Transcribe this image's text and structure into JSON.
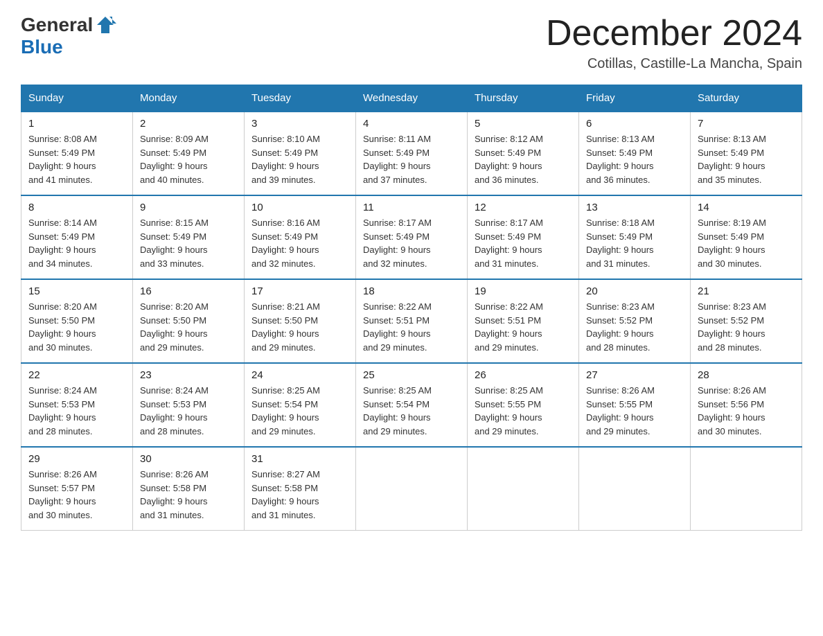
{
  "header": {
    "logo_general": "General",
    "logo_blue": "Blue",
    "month_title": "December 2024",
    "location": "Cotillas, Castille-La Mancha, Spain"
  },
  "weekdays": [
    "Sunday",
    "Monday",
    "Tuesday",
    "Wednesday",
    "Thursday",
    "Friday",
    "Saturday"
  ],
  "weeks": [
    [
      {
        "day": "1",
        "sunrise": "8:08 AM",
        "sunset": "5:49 PM",
        "daylight": "9 hours and 41 minutes."
      },
      {
        "day": "2",
        "sunrise": "8:09 AM",
        "sunset": "5:49 PM",
        "daylight": "9 hours and 40 minutes."
      },
      {
        "day": "3",
        "sunrise": "8:10 AM",
        "sunset": "5:49 PM",
        "daylight": "9 hours and 39 minutes."
      },
      {
        "day": "4",
        "sunrise": "8:11 AM",
        "sunset": "5:49 PM",
        "daylight": "9 hours and 37 minutes."
      },
      {
        "day": "5",
        "sunrise": "8:12 AM",
        "sunset": "5:49 PM",
        "daylight": "9 hours and 36 minutes."
      },
      {
        "day": "6",
        "sunrise": "8:13 AM",
        "sunset": "5:49 PM",
        "daylight": "9 hours and 36 minutes."
      },
      {
        "day": "7",
        "sunrise": "8:13 AM",
        "sunset": "5:49 PM",
        "daylight": "9 hours and 35 minutes."
      }
    ],
    [
      {
        "day": "8",
        "sunrise": "8:14 AM",
        "sunset": "5:49 PM",
        "daylight": "9 hours and 34 minutes."
      },
      {
        "day": "9",
        "sunrise": "8:15 AM",
        "sunset": "5:49 PM",
        "daylight": "9 hours and 33 minutes."
      },
      {
        "day": "10",
        "sunrise": "8:16 AM",
        "sunset": "5:49 PM",
        "daylight": "9 hours and 32 minutes."
      },
      {
        "day": "11",
        "sunrise": "8:17 AM",
        "sunset": "5:49 PM",
        "daylight": "9 hours and 32 minutes."
      },
      {
        "day": "12",
        "sunrise": "8:17 AM",
        "sunset": "5:49 PM",
        "daylight": "9 hours and 31 minutes."
      },
      {
        "day": "13",
        "sunrise": "8:18 AM",
        "sunset": "5:49 PM",
        "daylight": "9 hours and 31 minutes."
      },
      {
        "day": "14",
        "sunrise": "8:19 AM",
        "sunset": "5:49 PM",
        "daylight": "9 hours and 30 minutes."
      }
    ],
    [
      {
        "day": "15",
        "sunrise": "8:20 AM",
        "sunset": "5:50 PM",
        "daylight": "9 hours and 30 minutes."
      },
      {
        "day": "16",
        "sunrise": "8:20 AM",
        "sunset": "5:50 PM",
        "daylight": "9 hours and 29 minutes."
      },
      {
        "day": "17",
        "sunrise": "8:21 AM",
        "sunset": "5:50 PM",
        "daylight": "9 hours and 29 minutes."
      },
      {
        "day": "18",
        "sunrise": "8:22 AM",
        "sunset": "5:51 PM",
        "daylight": "9 hours and 29 minutes."
      },
      {
        "day": "19",
        "sunrise": "8:22 AM",
        "sunset": "5:51 PM",
        "daylight": "9 hours and 29 minutes."
      },
      {
        "day": "20",
        "sunrise": "8:23 AM",
        "sunset": "5:52 PM",
        "daylight": "9 hours and 28 minutes."
      },
      {
        "day": "21",
        "sunrise": "8:23 AM",
        "sunset": "5:52 PM",
        "daylight": "9 hours and 28 minutes."
      }
    ],
    [
      {
        "day": "22",
        "sunrise": "8:24 AM",
        "sunset": "5:53 PM",
        "daylight": "9 hours and 28 minutes."
      },
      {
        "day": "23",
        "sunrise": "8:24 AM",
        "sunset": "5:53 PM",
        "daylight": "9 hours and 28 minutes."
      },
      {
        "day": "24",
        "sunrise": "8:25 AM",
        "sunset": "5:54 PM",
        "daylight": "9 hours and 29 minutes."
      },
      {
        "day": "25",
        "sunrise": "8:25 AM",
        "sunset": "5:54 PM",
        "daylight": "9 hours and 29 minutes."
      },
      {
        "day": "26",
        "sunrise": "8:25 AM",
        "sunset": "5:55 PM",
        "daylight": "9 hours and 29 minutes."
      },
      {
        "day": "27",
        "sunrise": "8:26 AM",
        "sunset": "5:55 PM",
        "daylight": "9 hours and 29 minutes."
      },
      {
        "day": "28",
        "sunrise": "8:26 AM",
        "sunset": "5:56 PM",
        "daylight": "9 hours and 30 minutes."
      }
    ],
    [
      {
        "day": "29",
        "sunrise": "8:26 AM",
        "sunset": "5:57 PM",
        "daylight": "9 hours and 30 minutes."
      },
      {
        "day": "30",
        "sunrise": "8:26 AM",
        "sunset": "5:58 PM",
        "daylight": "9 hours and 31 minutes."
      },
      {
        "day": "31",
        "sunrise": "8:27 AM",
        "sunset": "5:58 PM",
        "daylight": "9 hours and 31 minutes."
      },
      null,
      null,
      null,
      null
    ]
  ],
  "labels": {
    "sunrise": "Sunrise:",
    "sunset": "Sunset:",
    "daylight": "Daylight:"
  }
}
